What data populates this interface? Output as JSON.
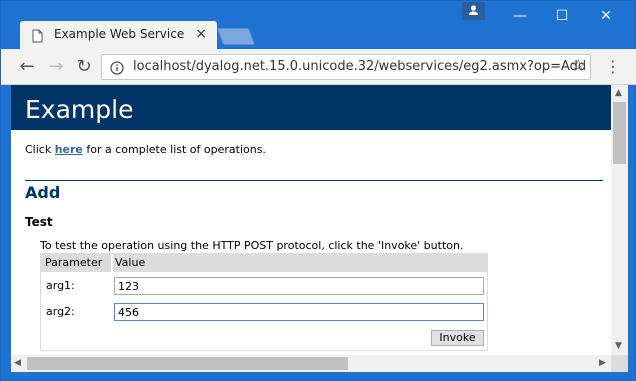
{
  "tab": {
    "title": "Example Web Service",
    "close_label": "×"
  },
  "window_controls": {
    "minimize": "—",
    "maximize": "☐",
    "close": "✕"
  },
  "address_bar": {
    "url": "localhost/dyalog.net.15.0.unicode.32/webservices/eg2.asmx?op=Add"
  },
  "nav": {
    "back": "←",
    "forward": "→",
    "reload": "↻",
    "star": "☆",
    "menu": "⋮"
  },
  "page": {
    "header_title": "Example",
    "intro_prefix": "Click ",
    "intro_link": "here",
    "intro_suffix": " for a complete list of operations.",
    "operation_title": "Add",
    "section_title": "Test",
    "instructions": "To test the operation using the HTTP POST protocol, click the 'Invoke' button.",
    "table": {
      "headers": [
        "Parameter",
        "Value"
      ],
      "rows": [
        {
          "label": "arg1:",
          "value": "123"
        },
        {
          "label": "arg2:",
          "value": "456"
        }
      ]
    },
    "invoke_label": "Invoke"
  },
  "scrollbar_arrows": {
    "up": "▲",
    "down": "▼",
    "left": "◀",
    "right": "▶"
  },
  "colors": {
    "titlebar": "#1e73d2",
    "header_bg": "#003366",
    "heading_text": "#003366",
    "link": "#336699"
  }
}
